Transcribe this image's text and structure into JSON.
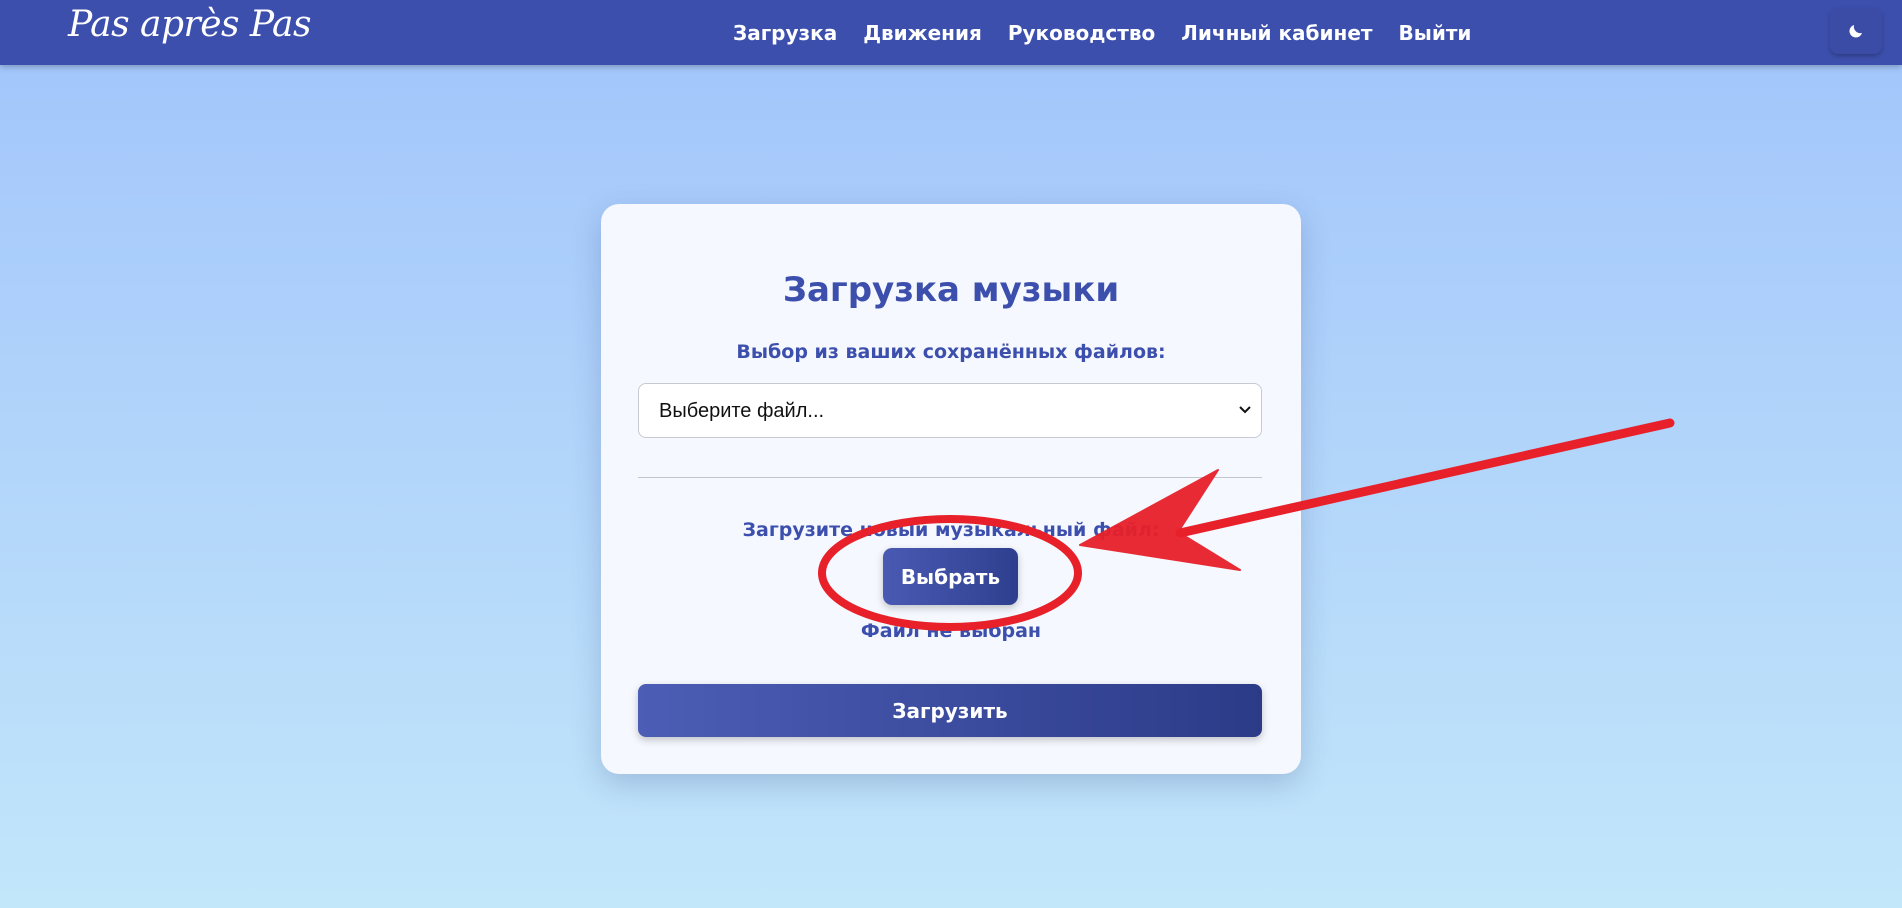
{
  "brand": {
    "logo_text": "Pas après Pas"
  },
  "nav": {
    "links": [
      "Загрузка",
      "Движения",
      "Руководство",
      "Личный кабинет",
      "Выйти"
    ]
  },
  "theme_toggle": {
    "icon": "moon-icon"
  },
  "card": {
    "title": "Загрузка музыки",
    "saved_label": "Выбор из ваших сохранённых файлов:",
    "select_placeholder": "Выберите файл...",
    "new_file_label": "Загрузите новый музыкальный файл:",
    "choose_button": "Выбрать",
    "no_file_text": "Файл не выбран",
    "upload_button": "Загрузить"
  },
  "annotation": {
    "color": "#e8202a"
  }
}
